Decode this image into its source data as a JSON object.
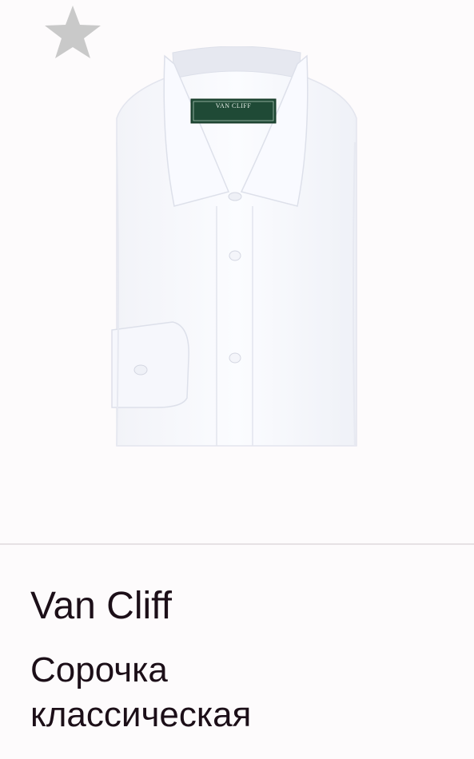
{
  "product": {
    "brand": "Van Cliff",
    "title_line1": "Сорочка",
    "title_line2": "классическая",
    "label_text": "VAN CLIFF",
    "image_icon": "white-dress-shirt"
  },
  "favorite": {
    "icon": "star-icon",
    "color": "#c9c9c9"
  },
  "colors": {
    "background": "#fdfbfc",
    "text": "#1c0f18",
    "divider": "#e6e1e4",
    "label_green": "#1f4a36"
  }
}
